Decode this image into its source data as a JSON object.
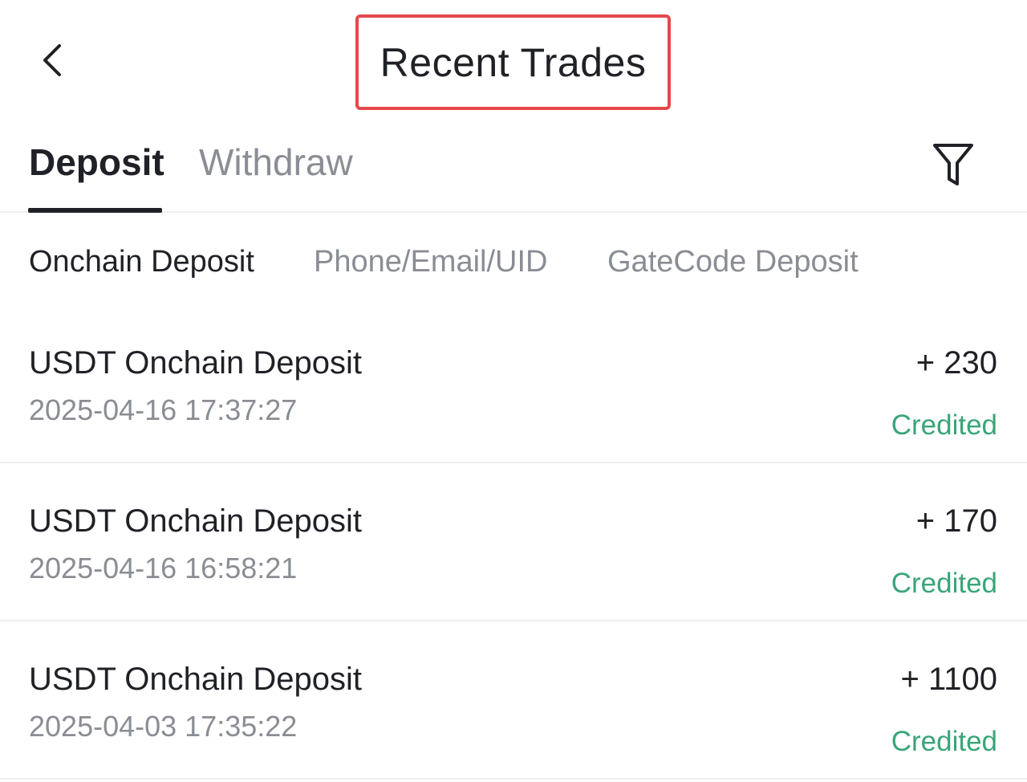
{
  "header": {
    "title": "Recent Trades",
    "back_icon": "chevron-left-icon"
  },
  "tabs": {
    "items": [
      {
        "label": "Deposit",
        "active": true
      },
      {
        "label": "Withdraw",
        "active": false
      }
    ],
    "filter_icon": "filter-icon"
  },
  "subtabs": {
    "items": [
      {
        "label": "Onchain Deposit",
        "active": true
      },
      {
        "label": "Phone/Email/UID",
        "active": false
      },
      {
        "label": "GateCode Deposit",
        "active": false
      }
    ]
  },
  "records": [
    {
      "title": "USDT Onchain Deposit",
      "time": "2025-04-16 17:37:27",
      "amount": "+ 230",
      "status": "Credited"
    },
    {
      "title": "USDT Onchain Deposit",
      "time": "2025-04-16 16:58:21",
      "amount": "+ 170",
      "status": "Credited"
    },
    {
      "title": "USDT Onchain Deposit",
      "time": "2025-04-03 17:35:22",
      "amount": "+ 1100",
      "status": "Credited"
    }
  ],
  "colors": {
    "primary_text": "#1f2126",
    "secondary_text": "#8a8d94",
    "status_success": "#3aa578",
    "highlight_border": "#e5484d"
  }
}
